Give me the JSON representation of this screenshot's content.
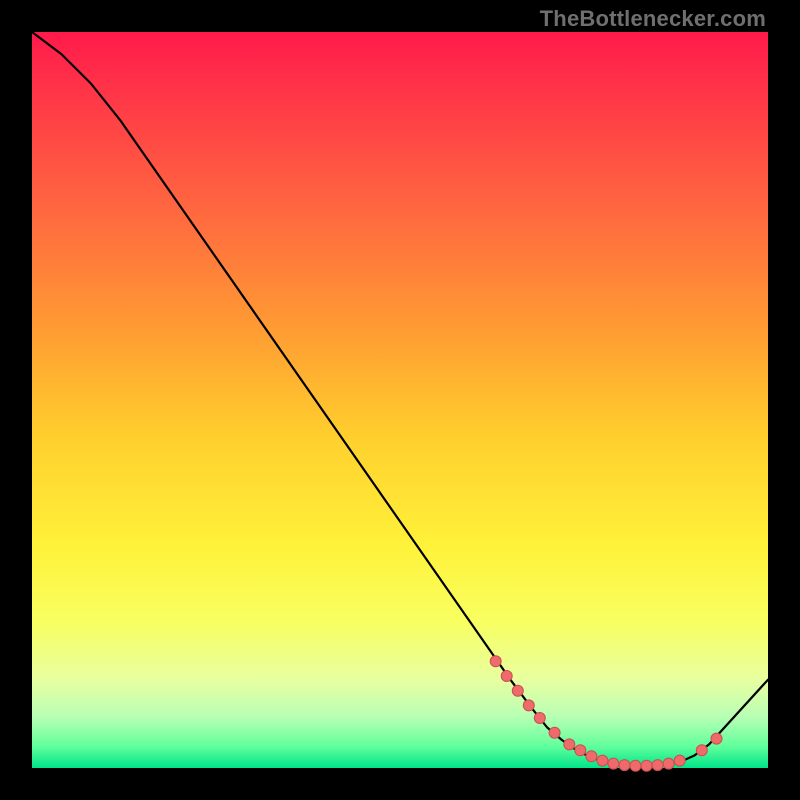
{
  "credit": "TheBottlenecker.com",
  "colors": {
    "curve": "#000000",
    "marker_fill": "#ef6a6a",
    "marker_stroke": "#c94f4f",
    "gradient_top": "#ff1a4b",
    "gradient_bottom": "#00e58a"
  },
  "chart_data": {
    "type": "line",
    "title": "",
    "xlabel": "",
    "ylabel": "",
    "xlim": [
      0,
      100
    ],
    "ylim": [
      0,
      100
    ],
    "grid": false,
    "legend": false,
    "series": [
      {
        "name": "bottleneck-curve",
        "x": [
          0,
          4,
          8,
          12,
          65,
          68,
          70,
          72,
          74,
          76,
          78,
          80,
          82,
          84,
          86,
          88,
          90,
          92,
          100
        ],
        "y": [
          100,
          97,
          93,
          88,
          12,
          8,
          5.5,
          3.8,
          2.4,
          1.4,
          0.8,
          0.4,
          0.2,
          0.2,
          0.4,
          0.8,
          1.7,
          3.2,
          12
        ]
      }
    ],
    "markers": {
      "name": "highlight-points",
      "x": [
        63,
        64.5,
        66,
        67.5,
        69,
        71,
        73,
        74.5,
        76,
        77.5,
        79,
        80.5,
        82,
        83.5,
        85,
        86.5,
        88,
        91,
        93
      ],
      "y": [
        14.5,
        12.5,
        10.5,
        8.5,
        6.8,
        4.8,
        3.2,
        2.4,
        1.6,
        1.0,
        0.6,
        0.4,
        0.3,
        0.3,
        0.4,
        0.6,
        1.0,
        2.4,
        4.0
      ]
    }
  }
}
